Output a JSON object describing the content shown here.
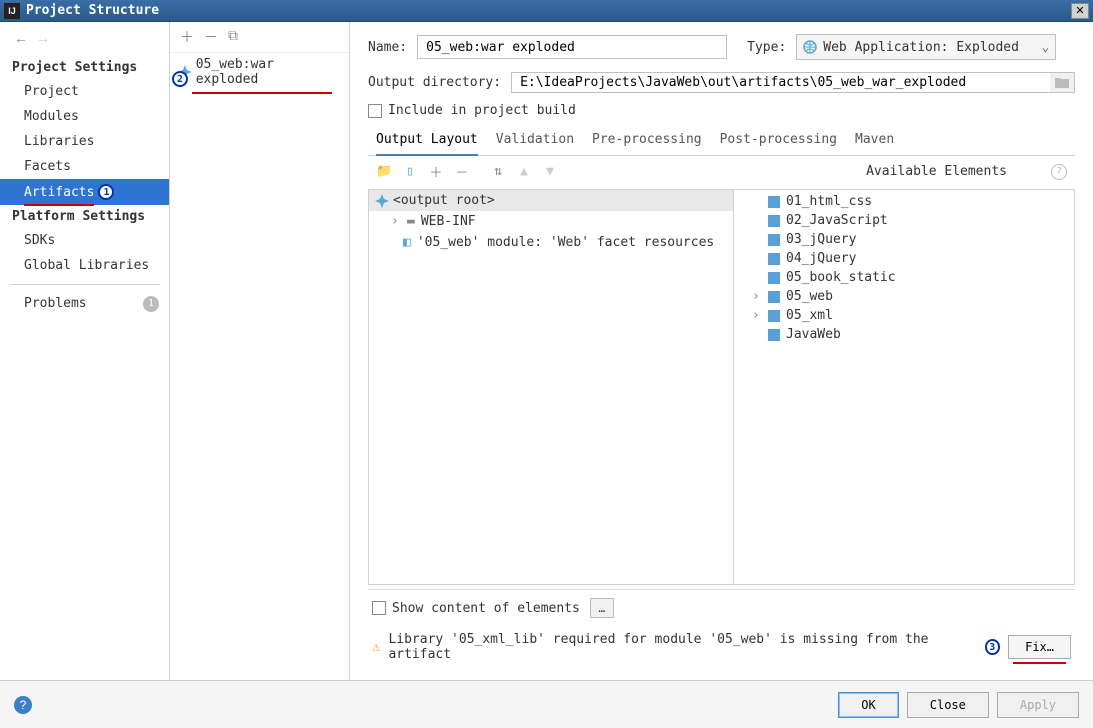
{
  "window": {
    "title": "Project Structure"
  },
  "sidebar": {
    "project_settings_header": "Project Settings",
    "platform_settings_header": "Platform Settings",
    "items": {
      "project": "Project",
      "modules": "Modules",
      "libraries": "Libraries",
      "facets": "Facets",
      "artifacts": "Artifacts",
      "sdks": "SDKs",
      "global_libraries": "Global Libraries",
      "problems": "Problems"
    },
    "problems_count": "1"
  },
  "annotations": {
    "a1": "1",
    "a2": "2",
    "a3": "3"
  },
  "artifact_list": {
    "item0": "05_web:war exploded"
  },
  "form": {
    "name_label": "Name:",
    "name_value": "05_web:war exploded",
    "type_label": "Type:",
    "type_value": "Web Application: Exploded",
    "output_dir_label": "Output directory:",
    "output_dir_value": "E:\\IdeaProjects\\JavaWeb\\out\\artifacts\\05_web_war_exploded",
    "include_build_label": "Include in project build"
  },
  "tabs": {
    "output_layout": "Output Layout",
    "validation": "Validation",
    "pre_processing": "Pre-processing",
    "post_processing": "Post-processing",
    "maven": "Maven"
  },
  "layout": {
    "available_label": "Available Elements",
    "output_root": "<output root>",
    "webinf": "WEB-INF",
    "facet_res": "'05_web' module: 'Web' facet resources"
  },
  "available": {
    "e0": "01_html_css",
    "e1": "02_JavaScript",
    "e2": "03_jQuery",
    "e3": "04_jQuery",
    "e4": "05_book_static",
    "e5": "05_web",
    "e6": "05_xml",
    "e7": "JavaWeb"
  },
  "bottom": {
    "show_content": "Show content of elements",
    "warning": "Library '05_xml_lib' required for module '05_web' is missing from the artifact",
    "fix": "Fix…"
  },
  "buttons": {
    "ok": "OK",
    "close": "Close",
    "apply": "Apply"
  }
}
